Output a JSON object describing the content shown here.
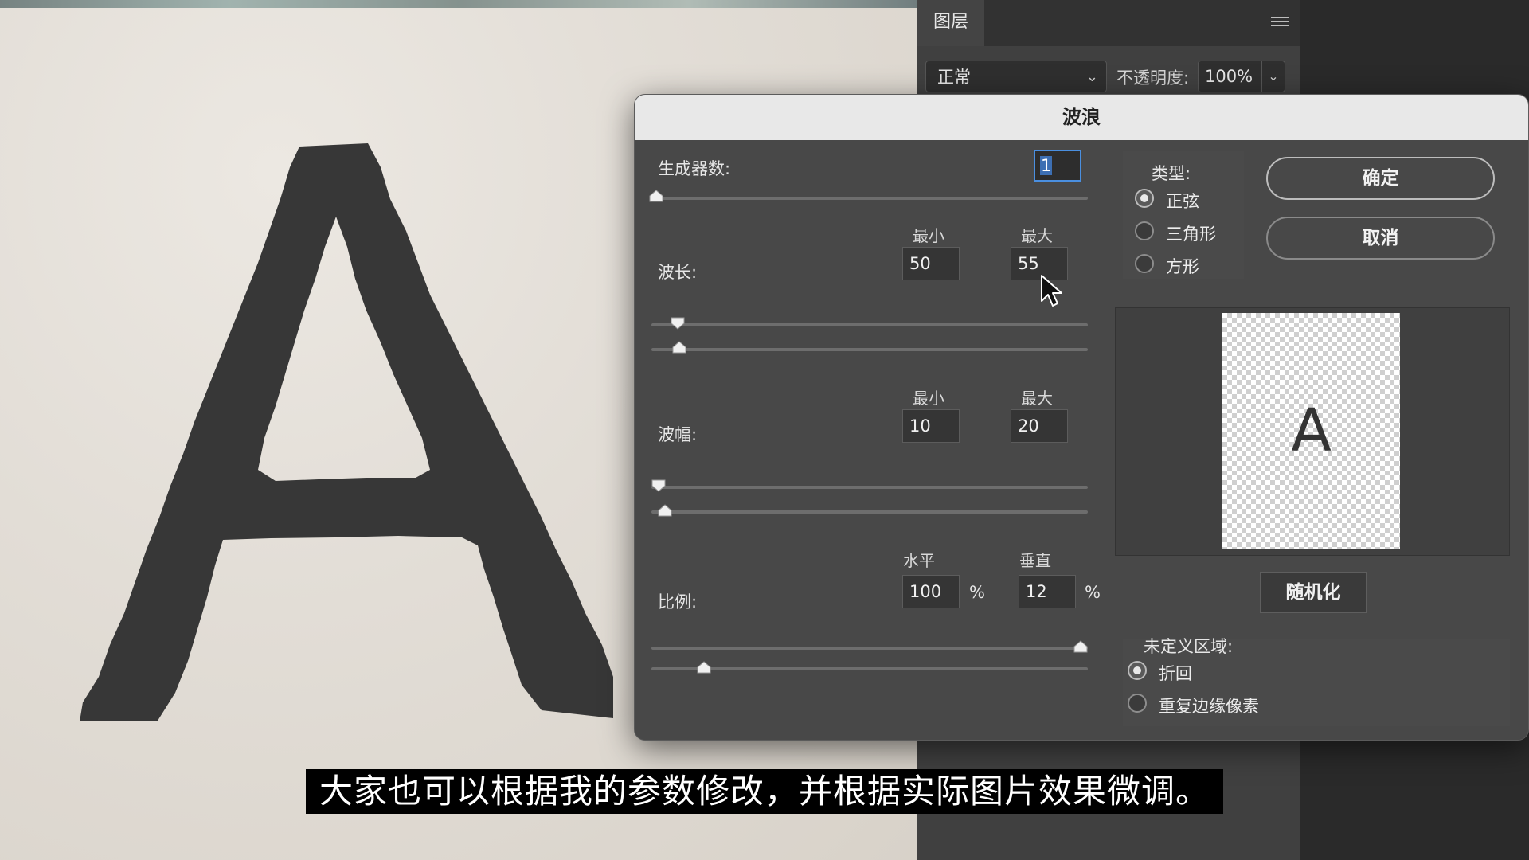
{
  "layers_panel": {
    "tab_label": "图层",
    "blend_mode": "正常",
    "opacity_label": "不透明度:",
    "opacity_value": "100%"
  },
  "canvas": {
    "letter": "A"
  },
  "dialog": {
    "title": "波浪",
    "generators": {
      "label": "生成器数:",
      "value": "1"
    },
    "wavelength": {
      "label": "波长:",
      "min_label": "最小",
      "max_label": "最大",
      "min": "50",
      "max": "55"
    },
    "amplitude": {
      "label": "波幅:",
      "min_label": "最小",
      "max_label": "最大",
      "min": "10",
      "max": "20"
    },
    "scale": {
      "label": "比例:",
      "h_label": "水平",
      "v_label": "垂直",
      "h": "100",
      "v": "12",
      "unit": "%"
    },
    "type": {
      "label": "类型:",
      "options": [
        "正弦",
        "三角形",
        "方形"
      ],
      "selected": "正弦"
    },
    "ok_label": "确定",
    "cancel_label": "取消",
    "preview_letter": "A",
    "randomize_label": "随机化",
    "undefined_area": {
      "label": "未定义区域:",
      "options": [
        "折回",
        "重复边缘像素"
      ],
      "selected": "折回"
    }
  },
  "subtitle": "大家也可以根据我的参数修改，并根据实际图片效果微调。"
}
